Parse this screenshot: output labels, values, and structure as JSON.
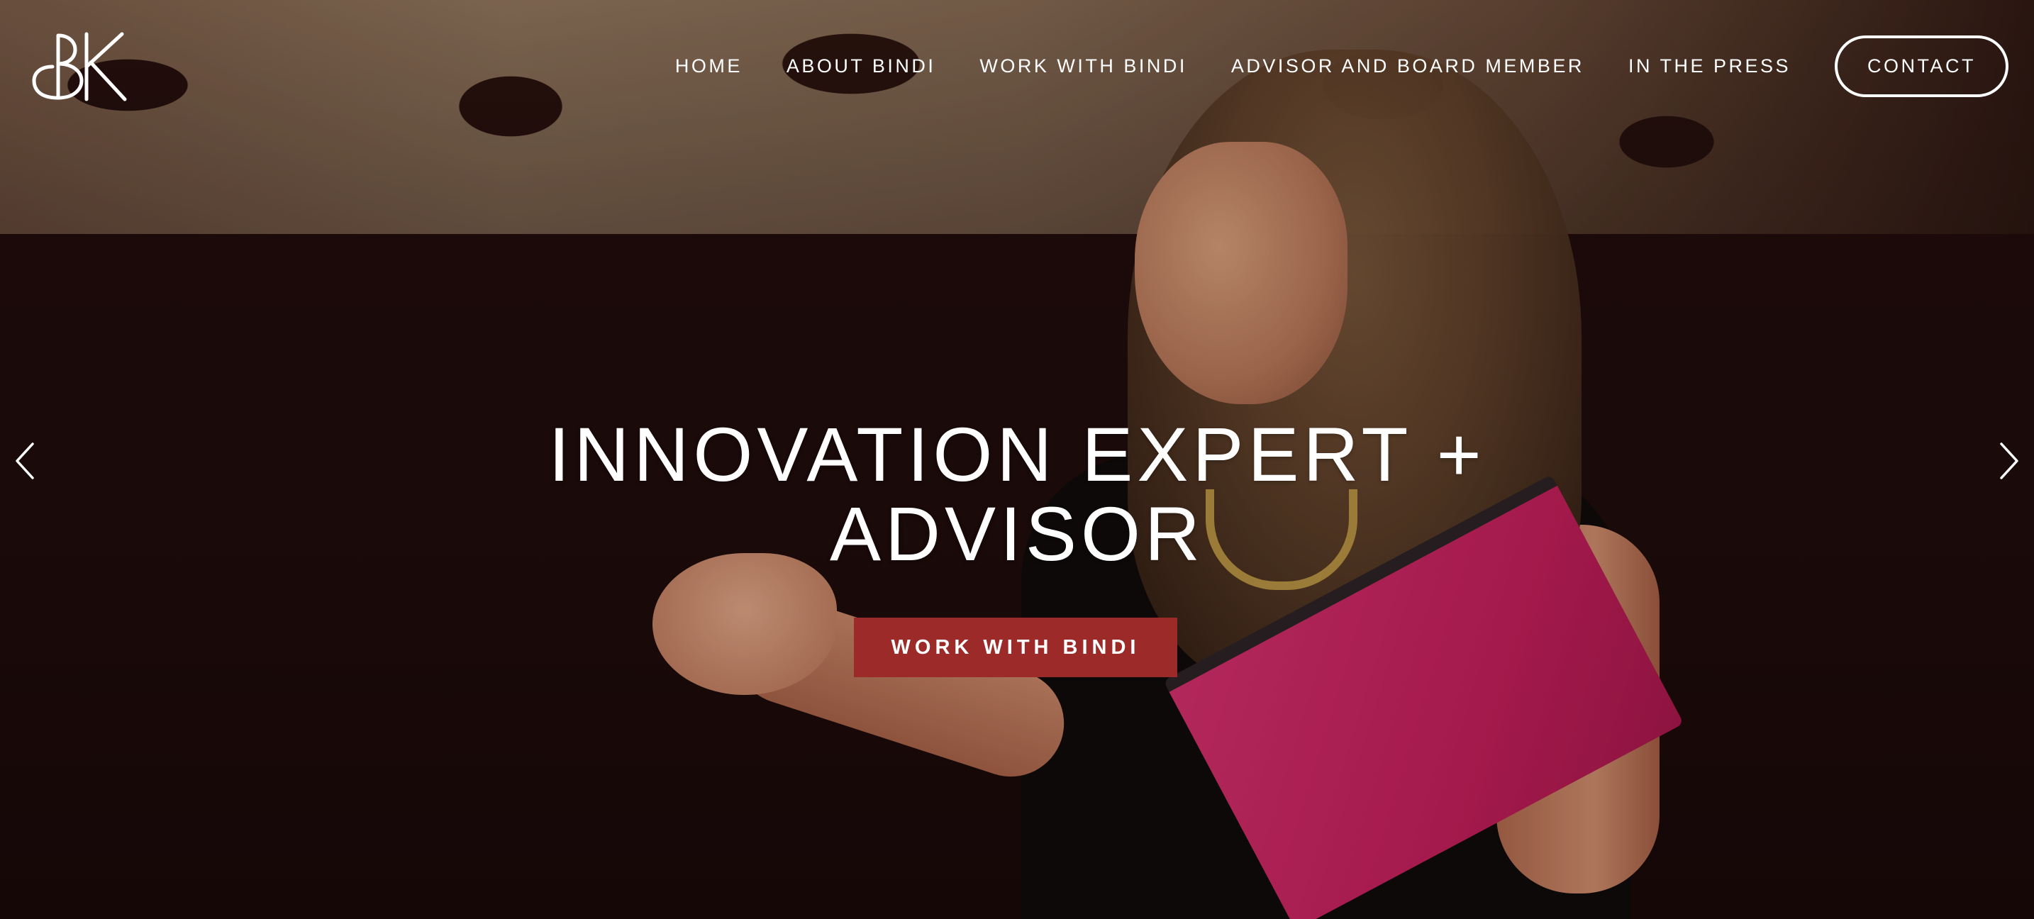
{
  "header": {
    "logo_text": "BK",
    "nav": [
      {
        "label": "HOME"
      },
      {
        "label": "ABOUT BINDI"
      },
      {
        "label": "WORK WITH BINDI"
      },
      {
        "label": "ADVISOR AND BOARD MEMBER"
      },
      {
        "label": "IN THE PRESS"
      }
    ],
    "contact_label": "CONTACT"
  },
  "hero": {
    "title_line1": "INNOVATION EXPERT +",
    "title_line2": "ADVISOR",
    "cta_label": "WORK WITH BINDI",
    "cta_color": "#9b2a28",
    "prev_icon": "chevron-left-icon",
    "next_icon": "chevron-right-icon"
  },
  "colors": {
    "text": "#ffffff",
    "background": "#1c0d0d",
    "accent": "#9b2a28"
  }
}
